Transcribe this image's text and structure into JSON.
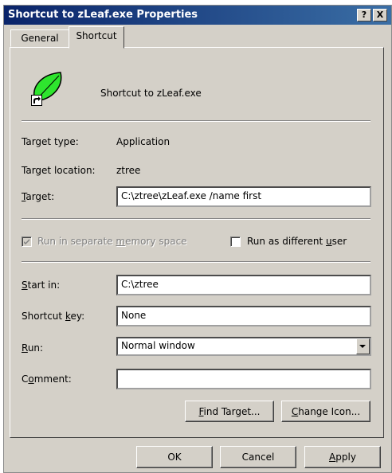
{
  "window": {
    "title": "Shortcut to zLeaf.exe Properties",
    "help_btn": "?",
    "close_btn": "X"
  },
  "tabs": [
    {
      "label": "General"
    },
    {
      "label": "Shortcut"
    }
  ],
  "shortcut": {
    "name": "Shortcut to zLeaf.exe",
    "target_type_label": "Target type:",
    "target_type_value": "Application",
    "target_location_label": "Target location:",
    "target_location_value": "ztree",
    "target_label": "Target:",
    "target_value": "C:\\ztree\\zLeaf.exe /name first",
    "run_separate_label": "Run in separate memory space",
    "run_separate_checked": true,
    "run_as_label": "Run as different user",
    "run_as_checked": false,
    "start_in_label": "Start in:",
    "start_in_value": "C:\\ztree",
    "shortcut_key_label": "Shortcut key:",
    "shortcut_key_value": "None",
    "run_label": "Run:",
    "run_value": "Normal window",
    "comment_label": "Comment:",
    "comment_value": "",
    "find_target_label": "Find Target...",
    "change_icon_label": "Change Icon..."
  },
  "footer": {
    "ok": "OK",
    "cancel": "Cancel",
    "apply": "Apply"
  },
  "icons": {
    "app": "leaf-icon",
    "shortcut": "shortcut-arrow-icon",
    "dropdown": "dropdown-arrow-icon"
  },
  "colors": {
    "face": "#d4d0c8",
    "titlebar": "#0a246a",
    "leaf": "#2ee52e"
  }
}
